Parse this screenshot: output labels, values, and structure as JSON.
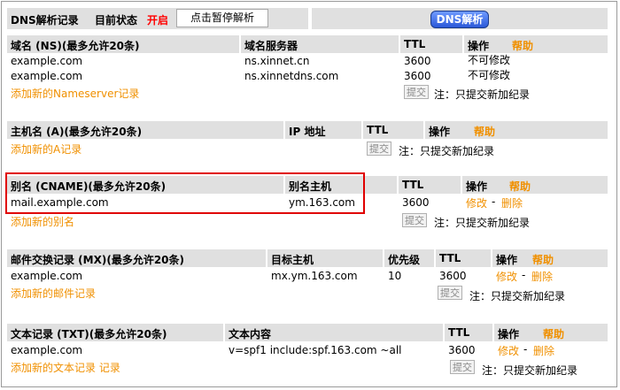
{
  "top": {
    "title": "DNS解析记录",
    "status_label": "目前状态",
    "status_value": "开启",
    "pause_button": "点击暂停解析",
    "dns_button": "DNS解析"
  },
  "ns": {
    "col_domain": "域名 (NS)(最多允许20条)",
    "col_server": "域名服务器",
    "col_ttl": "TTL",
    "col_op": "操作",
    "help": "帮助",
    "rows": [
      {
        "domain": "example.com",
        "server": "ns.xinnet.cn",
        "ttl": "3600",
        "op": "不可修改"
      },
      {
        "domain": "example.com",
        "server": "ns.xinnetdns.com",
        "ttl": "3600",
        "op": "不可修改"
      }
    ],
    "add_link": "添加新的Nameserver记录",
    "submit": "提交",
    "note": "注：只提交新加纪录"
  },
  "a": {
    "col_host": "主机名 (A)(最多允许20条)",
    "col_ip": "IP 地址",
    "col_ttl": "TTL",
    "col_op": "操作",
    "help": "帮助",
    "add_link": "添加新的A记录",
    "submit": "提交",
    "note": "注：只提交新加纪录"
  },
  "cname": {
    "col_alias": "别名 (CNAME)(最多允许20条)",
    "col_host": "别名主机",
    "col_ttl": "TTL",
    "col_op": "操作",
    "help": "帮助",
    "row": {
      "alias": "mail.example.com",
      "host": "ym.163.com",
      "ttl": "3600",
      "edit": "修改",
      "sep": "-",
      "del": "删除"
    },
    "add_link": "添加新的别名",
    "submit": "提交",
    "note": "注：只提交新加纪录"
  },
  "mx": {
    "col_record": "邮件交换记录 (MX)(最多允许20条)",
    "col_host": "目标主机",
    "col_priority": "优先级",
    "col_ttl": "TTL",
    "col_op": "操作",
    "help": "帮助",
    "row": {
      "domain": "example.com",
      "host": "mx.ym.163.com",
      "priority": "10",
      "ttl": "3600",
      "edit": "修改",
      "sep": "-",
      "del": "删除"
    },
    "add_link": "添加新的邮件记录",
    "submit": "提交",
    "note": "注：只提交新加纪录"
  },
  "txt": {
    "col_record": "文本记录 (TXT)(最多允许20条)",
    "col_content": "文本内容",
    "col_ttl": "TTL",
    "col_op": "操作",
    "help": "帮助",
    "row": {
      "domain": "example.com",
      "content": "v=spf1 include:spf.163.com ~all",
      "ttl": "3600",
      "edit": "修改",
      "sep": "-",
      "del": "删除"
    },
    "add_link": "添加新的文本记录 记录",
    "submit": "提交",
    "note": "注：只提交新加纪录"
  }
}
